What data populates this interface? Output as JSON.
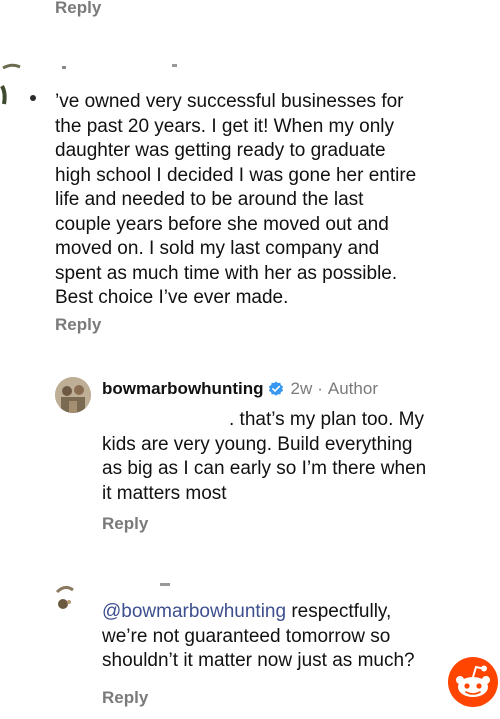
{
  "top_reply": {
    "label": "Reply"
  },
  "comment1": {
    "text": "’ve owned very successful businesses for\nthe past 20 years. I get it! When my only\ndaughter was getting ready to graduate\nhigh school I decided I was gone her entire\nlife and needed to be around the last\ncouple years before she moved out and\nmoved on. I sold my last company and\nspent as much time with her as possible.\nBest choice I’ve ever made.",
    "reply_label": "Reply"
  },
  "reply1": {
    "username": "bowmarbowhunting",
    "time": "2w",
    "separator": "·",
    "role": "Author",
    "line1": ". that’s my plan too. My",
    "rest": "kids are very young. Build everything\nas big as I can early so I’m there when\nit matters most",
    "reply_label": "Reply",
    "verified_color": "#3897f0"
  },
  "reply2": {
    "mention": "@bowmarbowhunting",
    "text": " respectfully,\nwe’re not guaranteed tomorrow so\nshouldn’t it matter now just as much?",
    "reply_label": "Reply"
  },
  "colors": {
    "accent_mention": "#3d4f8e",
    "reddit_orange": "#ff4500"
  }
}
